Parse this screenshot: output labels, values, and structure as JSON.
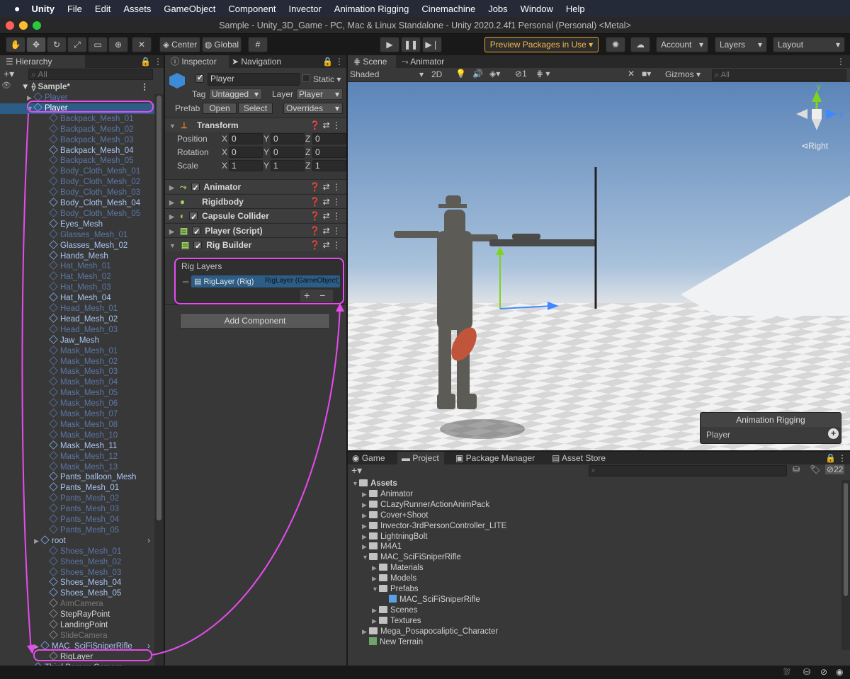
{
  "menubar": {
    "apple": "",
    "app": "Unity",
    "items": [
      "File",
      "Edit",
      "Assets",
      "GameObject",
      "Component",
      "Invector",
      "Animation Rigging",
      "Cinemachine",
      "Jobs",
      "Window",
      "Help"
    ]
  },
  "window": {
    "title": "Sample - Unity_3D_Game - PC, Mac & Linux Standalone - Unity 2020.2.4f1 Personal (Personal) <Metal>"
  },
  "toolbar": {
    "pivot": "Center",
    "space": "Global",
    "preview": "Preview Packages in Use",
    "account": "Account",
    "layers": "Layers",
    "layout": "Layout"
  },
  "hierarchy": {
    "tab": "Hierarchy",
    "search_placeholder": "All",
    "scene": "Sample*",
    "items": [
      {
        "label": "Player",
        "style": "dim",
        "indent": 1,
        "arrow": "▶"
      },
      {
        "label": "Player",
        "style": "sel",
        "indent": 1,
        "arrow": "▼"
      },
      {
        "label": "Backpack_Mesh_01",
        "style": "dim",
        "indent": 2
      },
      {
        "label": "Backpack_Mesh_02",
        "style": "dim",
        "indent": 2
      },
      {
        "label": "Backpack_Mesh_03",
        "style": "dim",
        "indent": 2
      },
      {
        "label": "Backpack_Mesh_04",
        "style": "bright",
        "indent": 2
      },
      {
        "label": "Backpack_Mesh_05",
        "style": "dim",
        "indent": 2
      },
      {
        "label": "Body_Cloth_Mesh_01",
        "style": "dim",
        "indent": 2
      },
      {
        "label": "Body_Cloth_Mesh_02",
        "style": "dim",
        "indent": 2
      },
      {
        "label": "Body_Cloth_Mesh_03",
        "style": "dim",
        "indent": 2
      },
      {
        "label": "Body_Cloth_Mesh_04",
        "style": "bright",
        "indent": 2
      },
      {
        "label": "Body_Cloth_Mesh_05",
        "style": "dim",
        "indent": 2
      },
      {
        "label": "Eyes_Mesh",
        "style": "bright",
        "indent": 2
      },
      {
        "label": "Glasses_Mesh_01",
        "style": "dim",
        "indent": 2
      },
      {
        "label": "Glasses_Mesh_02",
        "style": "bright",
        "indent": 2
      },
      {
        "label": "Hands_Mesh",
        "style": "bright",
        "indent": 2
      },
      {
        "label": "Hat_Mesh_01",
        "style": "dim",
        "indent": 2
      },
      {
        "label": "Hat_Mesh_02",
        "style": "dim",
        "indent": 2
      },
      {
        "label": "Hat_Mesh_03",
        "style": "dim",
        "indent": 2
      },
      {
        "label": "Hat_Mesh_04",
        "style": "bright",
        "indent": 2
      },
      {
        "label": "Head_Mesh_01",
        "style": "dim",
        "indent": 2
      },
      {
        "label": "Head_Mesh_02",
        "style": "bright",
        "indent": 2
      },
      {
        "label": "Head_Mesh_03",
        "style": "dim",
        "indent": 2
      },
      {
        "label": "Jaw_Mesh",
        "style": "bright",
        "indent": 2
      },
      {
        "label": "Mask_Mesh_01",
        "style": "dim",
        "indent": 2
      },
      {
        "label": "Mask_Mesh_02",
        "style": "dim",
        "indent": 2
      },
      {
        "label": "Mask_Mesh_03",
        "style": "dim",
        "indent": 2
      },
      {
        "label": "Mask_Mesh_04",
        "style": "dim",
        "indent": 2
      },
      {
        "label": "Mask_Mesh_05",
        "style": "dim",
        "indent": 2
      },
      {
        "label": "Mask_Mesh_06",
        "style": "dim",
        "indent": 2
      },
      {
        "label": "Mask_Mesh_07",
        "style": "dim",
        "indent": 2
      },
      {
        "label": "Mask_Mesh_08",
        "style": "dim",
        "indent": 2
      },
      {
        "label": "Mask_Mesh_10",
        "style": "dim",
        "indent": 2
      },
      {
        "label": "Mask_Mesh_11",
        "style": "bright",
        "indent": 2
      },
      {
        "label": "Mask_Mesh_12",
        "style": "dim",
        "indent": 2
      },
      {
        "label": "Mask_Mesh_13",
        "style": "dim",
        "indent": 2
      },
      {
        "label": "Pants_balloon_Mesh",
        "style": "bright",
        "indent": 2
      },
      {
        "label": "Pants_Mesh_01",
        "style": "bright",
        "indent": 2
      },
      {
        "label": "Pants_Mesh_02",
        "style": "dim",
        "indent": 2
      },
      {
        "label": "Pants_Mesh_03",
        "style": "dim",
        "indent": 2
      },
      {
        "label": "Pants_Mesh_04",
        "style": "dim",
        "indent": 2
      },
      {
        "label": "Pants_Mesh_05",
        "style": "dim",
        "indent": 2
      },
      {
        "label": "root",
        "style": "bright",
        "indent": 1.5,
        "arrow": "▶"
      },
      {
        "label": "Shoes_Mesh_01",
        "style": "dim",
        "indent": 2
      },
      {
        "label": "Shoes_Mesh_02",
        "style": "dim",
        "indent": 2
      },
      {
        "label": "Shoes_Mesh_03",
        "style": "dim",
        "indent": 2
      },
      {
        "label": "Shoes_Mesh_04",
        "style": "bright",
        "indent": 2
      },
      {
        "label": "Shoes_Mesh_05",
        "style": "bright",
        "indent": 2
      },
      {
        "label": "AimCamera",
        "style": "grey",
        "indent": 2
      },
      {
        "label": "StepRayPoint",
        "style": "white",
        "indent": 2
      },
      {
        "label": "LandingPoint",
        "style": "white",
        "indent": 2
      },
      {
        "label": "SlideCamera",
        "style": "grey",
        "indent": 2
      },
      {
        "label": "MAC_SciFiSniperRifle",
        "style": "bright",
        "indent": 1.5,
        "arrow": "▶"
      },
      {
        "label": "RigLayer",
        "style": "white",
        "indent": 2
      },
      {
        "label": "Third Person Camera",
        "style": "bright",
        "indent": 1,
        "arrow": "▶"
      }
    ]
  },
  "inspector": {
    "tabs": [
      "Inspector",
      "Navigation"
    ],
    "object_name": "Player",
    "static": "Static",
    "tag_label": "Tag",
    "tag": "Untagged",
    "layer_label": "Layer",
    "layer": "Player",
    "prefab_label": "Prefab",
    "open": "Open",
    "select": "Select",
    "overrides": "Overrides",
    "transform": {
      "title": "Transform",
      "rows": [
        {
          "label": "Position",
          "x": "0",
          "y": "0",
          "z": "0"
        },
        {
          "label": "Rotation",
          "x": "0",
          "y": "0",
          "z": "0"
        },
        {
          "label": "Scale",
          "x": "1",
          "y": "1",
          "z": "1"
        }
      ],
      "axes": [
        "X",
        "Y",
        "Z"
      ]
    },
    "components": [
      "Animator",
      "Rigidbody",
      "Capsule Collider",
      "Player (Script)",
      "Rig Builder"
    ],
    "rig_layers": {
      "title": "Rig Layers",
      "item": "RigLayer (Rig)",
      "object": "RigLayer (GameObject)",
      "add": "+",
      "remove": "−"
    },
    "add_component": "Add Component"
  },
  "scene": {
    "tabs": [
      "Scene",
      "Animator"
    ],
    "shading": "Shaded",
    "mode2d": "2D",
    "hidden_count": "1",
    "gizmos": "Gizmos",
    "search_placeholder": "All",
    "axis_y": "y",
    "axis_z": "z",
    "view": "Right",
    "overlay": {
      "title": "Animation Rigging",
      "item": "Player",
      "add": "+"
    }
  },
  "project": {
    "tabs": [
      "Game",
      "Project",
      "Package Manager",
      "Asset Store"
    ],
    "count": "22",
    "tree": [
      {
        "label": "Assets",
        "indent": 0,
        "arrow": "▼",
        "bold": true
      },
      {
        "label": "Animator",
        "indent": 1,
        "arrow": "▶"
      },
      {
        "label": "CLazyRunnerActionAnimPack",
        "indent": 1,
        "arrow": "▶"
      },
      {
        "label": "Cover+Shoot",
        "indent": 1,
        "arrow": "▶"
      },
      {
        "label": "Invector-3rdPersonController_LITE",
        "indent": 1,
        "arrow": "▶"
      },
      {
        "label": "LightningBolt",
        "indent": 1,
        "arrow": "▶"
      },
      {
        "label": "M4A1",
        "indent": 1,
        "arrow": "▶"
      },
      {
        "label": "MAC_SciFiSniperRifle",
        "indent": 1,
        "arrow": "▼"
      },
      {
        "label": "Materials",
        "indent": 2,
        "arrow": "▶"
      },
      {
        "label": "Models",
        "indent": 2,
        "arrow": "▶"
      },
      {
        "label": "Prefabs",
        "indent": 2,
        "arrow": "▼"
      },
      {
        "label": "MAC_SciFiSniperRifle",
        "indent": 3,
        "arrow": "",
        "prefab": true
      },
      {
        "label": "Scenes",
        "indent": 2,
        "arrow": "▶"
      },
      {
        "label": "Textures",
        "indent": 2,
        "arrow": "▶"
      },
      {
        "label": "Mega_Posapocaliptic_Character",
        "indent": 1,
        "arrow": "▶"
      },
      {
        "label": "New Terrain",
        "indent": 1,
        "arrow": "",
        "file": true
      }
    ]
  },
  "colors": {
    "selection": "#2c5d87",
    "highlight": "#e84af0",
    "preview": "#f2b84b"
  }
}
